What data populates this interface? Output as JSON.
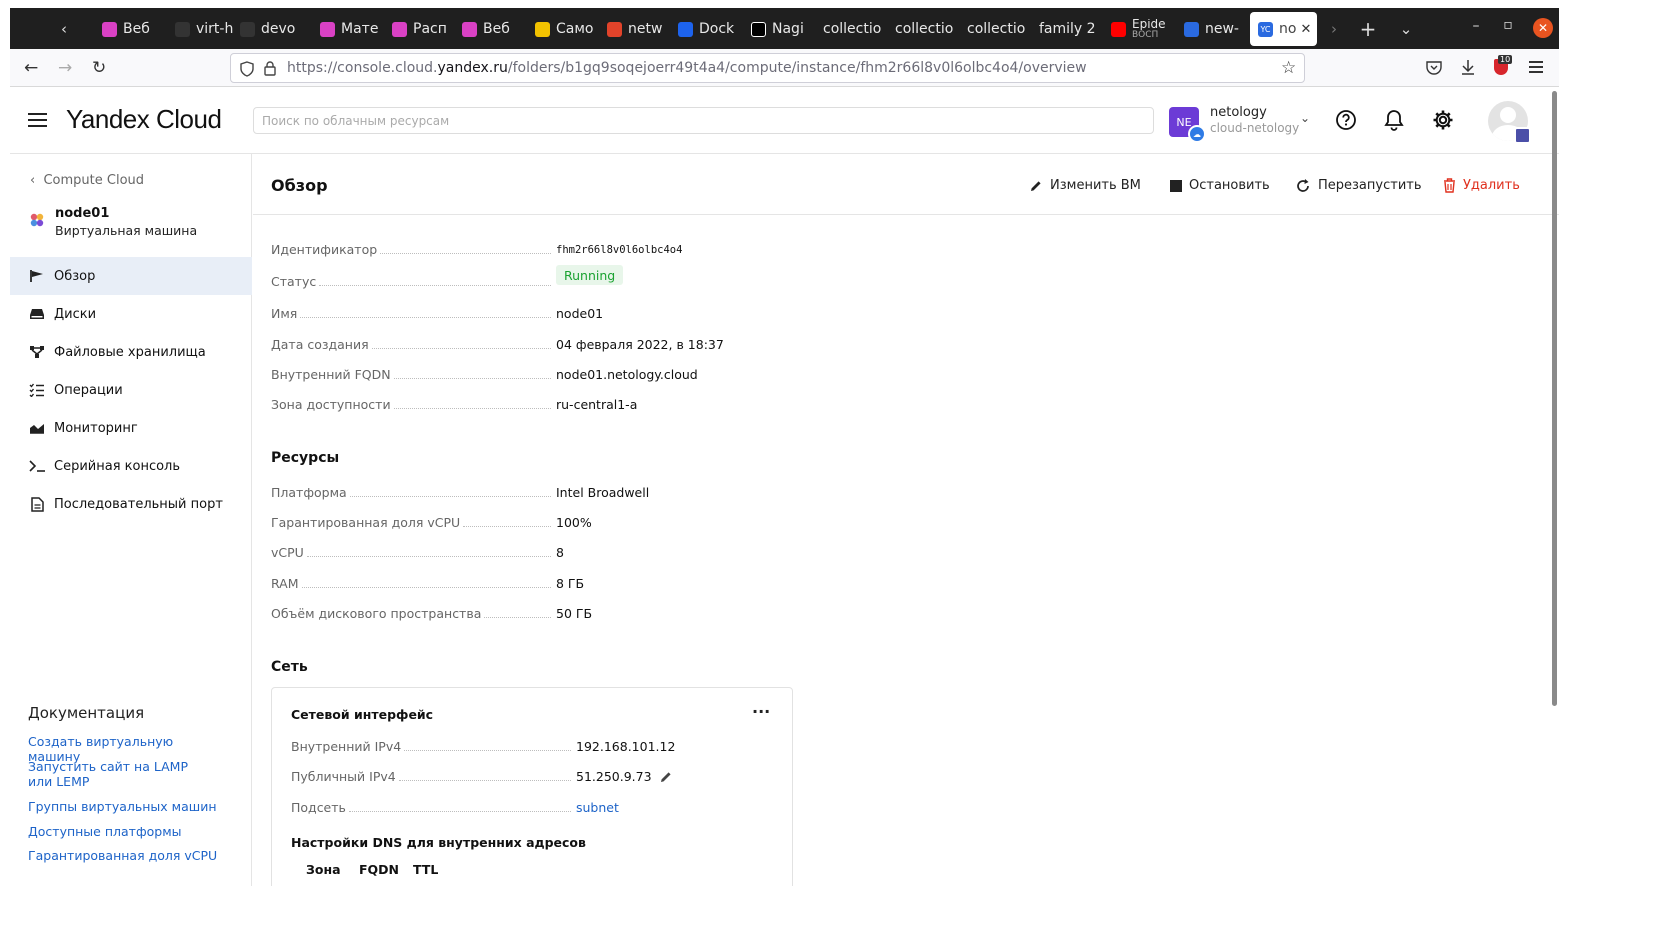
{
  "browser": {
    "tabs": [
      {
        "label": "Веб",
        "color": "#d941c4"
      },
      {
        "label": "virt-h",
        "color": "#333333"
      },
      {
        "label": "devo",
        "color": "#333333"
      },
      {
        "label": "Мате",
        "color": "#d941c4"
      },
      {
        "label": "Расп",
        "color": "#d941c4"
      },
      {
        "label": "Веб",
        "color": "#d941c4"
      },
      {
        "label": "Само",
        "color": "#f2c200"
      },
      {
        "label": "netw",
        "color": "#e2432a"
      },
      {
        "label": "Dock",
        "color": "#1d63ed"
      },
      {
        "label": "Nagi",
        "color": "#ffffff"
      },
      {
        "label": "collectio",
        "color": "#1f1f1f"
      },
      {
        "label": "collectio",
        "color": "#1f1f1f"
      },
      {
        "label": "collectio",
        "color": "#1f1f1f"
      },
      {
        "label": "family 2",
        "color": "#1f1f1f"
      },
      {
        "label": "Epide",
        "sub": "ВОСП",
        "color": "#ff0000"
      },
      {
        "label": "new-",
        "color": "#2a6ae0"
      }
    ],
    "active_tab": {
      "label": "no",
      "icon_text": "YC",
      "color": "#2a6ae0"
    },
    "url_prefix": "https://console.cloud.",
    "url_domain": "yandex.ru",
    "url_path": "/folders/b1gq9soqejoerr49t4a4/compute/instance/fhm2r66l8v0l6olbc4o4/overview",
    "addon_badge": "10"
  },
  "header": {
    "logo_a": "Yandex",
    "logo_b": "Cloud",
    "search_placeholder": "Поиск по облачным ресурсам",
    "account_initials": "NE",
    "account_name": "netology",
    "account_cloud": "cloud-netology"
  },
  "sidebar": {
    "back_label": "Compute Cloud",
    "vm_name": "node01",
    "vm_type": "Виртуальная машина",
    "items": [
      {
        "label": "Обзор",
        "icon": "flag-icon"
      },
      {
        "label": "Диски",
        "icon": "disk-icon"
      },
      {
        "label": "Файловые хранилища",
        "icon": "file-storage-icon"
      },
      {
        "label": "Операции",
        "icon": "operations-list-icon"
      },
      {
        "label": "Мониторинг",
        "icon": "monitoring-chart-icon"
      },
      {
        "label": "Серийная консоль",
        "icon": "terminal-icon"
      },
      {
        "label": "Последовательный порт",
        "icon": "document-icon"
      }
    ],
    "docs_title": "Документация",
    "docs": [
      "Создать виртуальную машину",
      "Запустить сайт на LAMP или LEMP",
      "Группы виртуальных машин",
      "Доступные платформы",
      "Гарантированная доля vCPU"
    ]
  },
  "main": {
    "title": "Обзор",
    "actions": {
      "edit": "Изменить ВМ",
      "stop": "Остановить",
      "restart": "Перезапустить",
      "delete": "Удалить"
    },
    "overview": {
      "id_label": "Идентификатор",
      "id_value": "fhm2r66l8v0l6olbc4o4",
      "status_label": "Статус",
      "status_value": "Running",
      "name_label": "Имя",
      "name_value": "node01",
      "created_label": "Дата создания",
      "created_value": "04 февраля 2022, в 18:37",
      "fqdn_label": "Внутренний FQDN",
      "fqdn_value": "node01.netology.cloud",
      "zone_label": "Зона доступности",
      "zone_value": "ru-central1-a"
    },
    "resources": {
      "title": "Ресурсы",
      "platform_label": "Платформа",
      "platform_value": "Intel Broadwell",
      "share_label": "Гарантированная доля vCPU",
      "share_value": "100%",
      "vcpu_label": "vCPU",
      "vcpu_value": "8",
      "ram_label": "RAM",
      "ram_value": "8 ГБ",
      "disk_label": "Объём дискового пространства",
      "disk_value": "50 ГБ"
    },
    "network": {
      "title": "Сеть",
      "card_title": "Сетевой интерфейс",
      "internal_label": "Внутренний IPv4",
      "internal_value": "192.168.101.12",
      "public_label": "Публичный IPv4",
      "public_value": "51.250.9.73",
      "subnet_label": "Подсеть",
      "subnet_value": "subnet",
      "dns_title": "Настройки DNS для внутренних адресов",
      "dns_cols": [
        "Зона",
        "FQDN",
        "TTL"
      ]
    }
  }
}
